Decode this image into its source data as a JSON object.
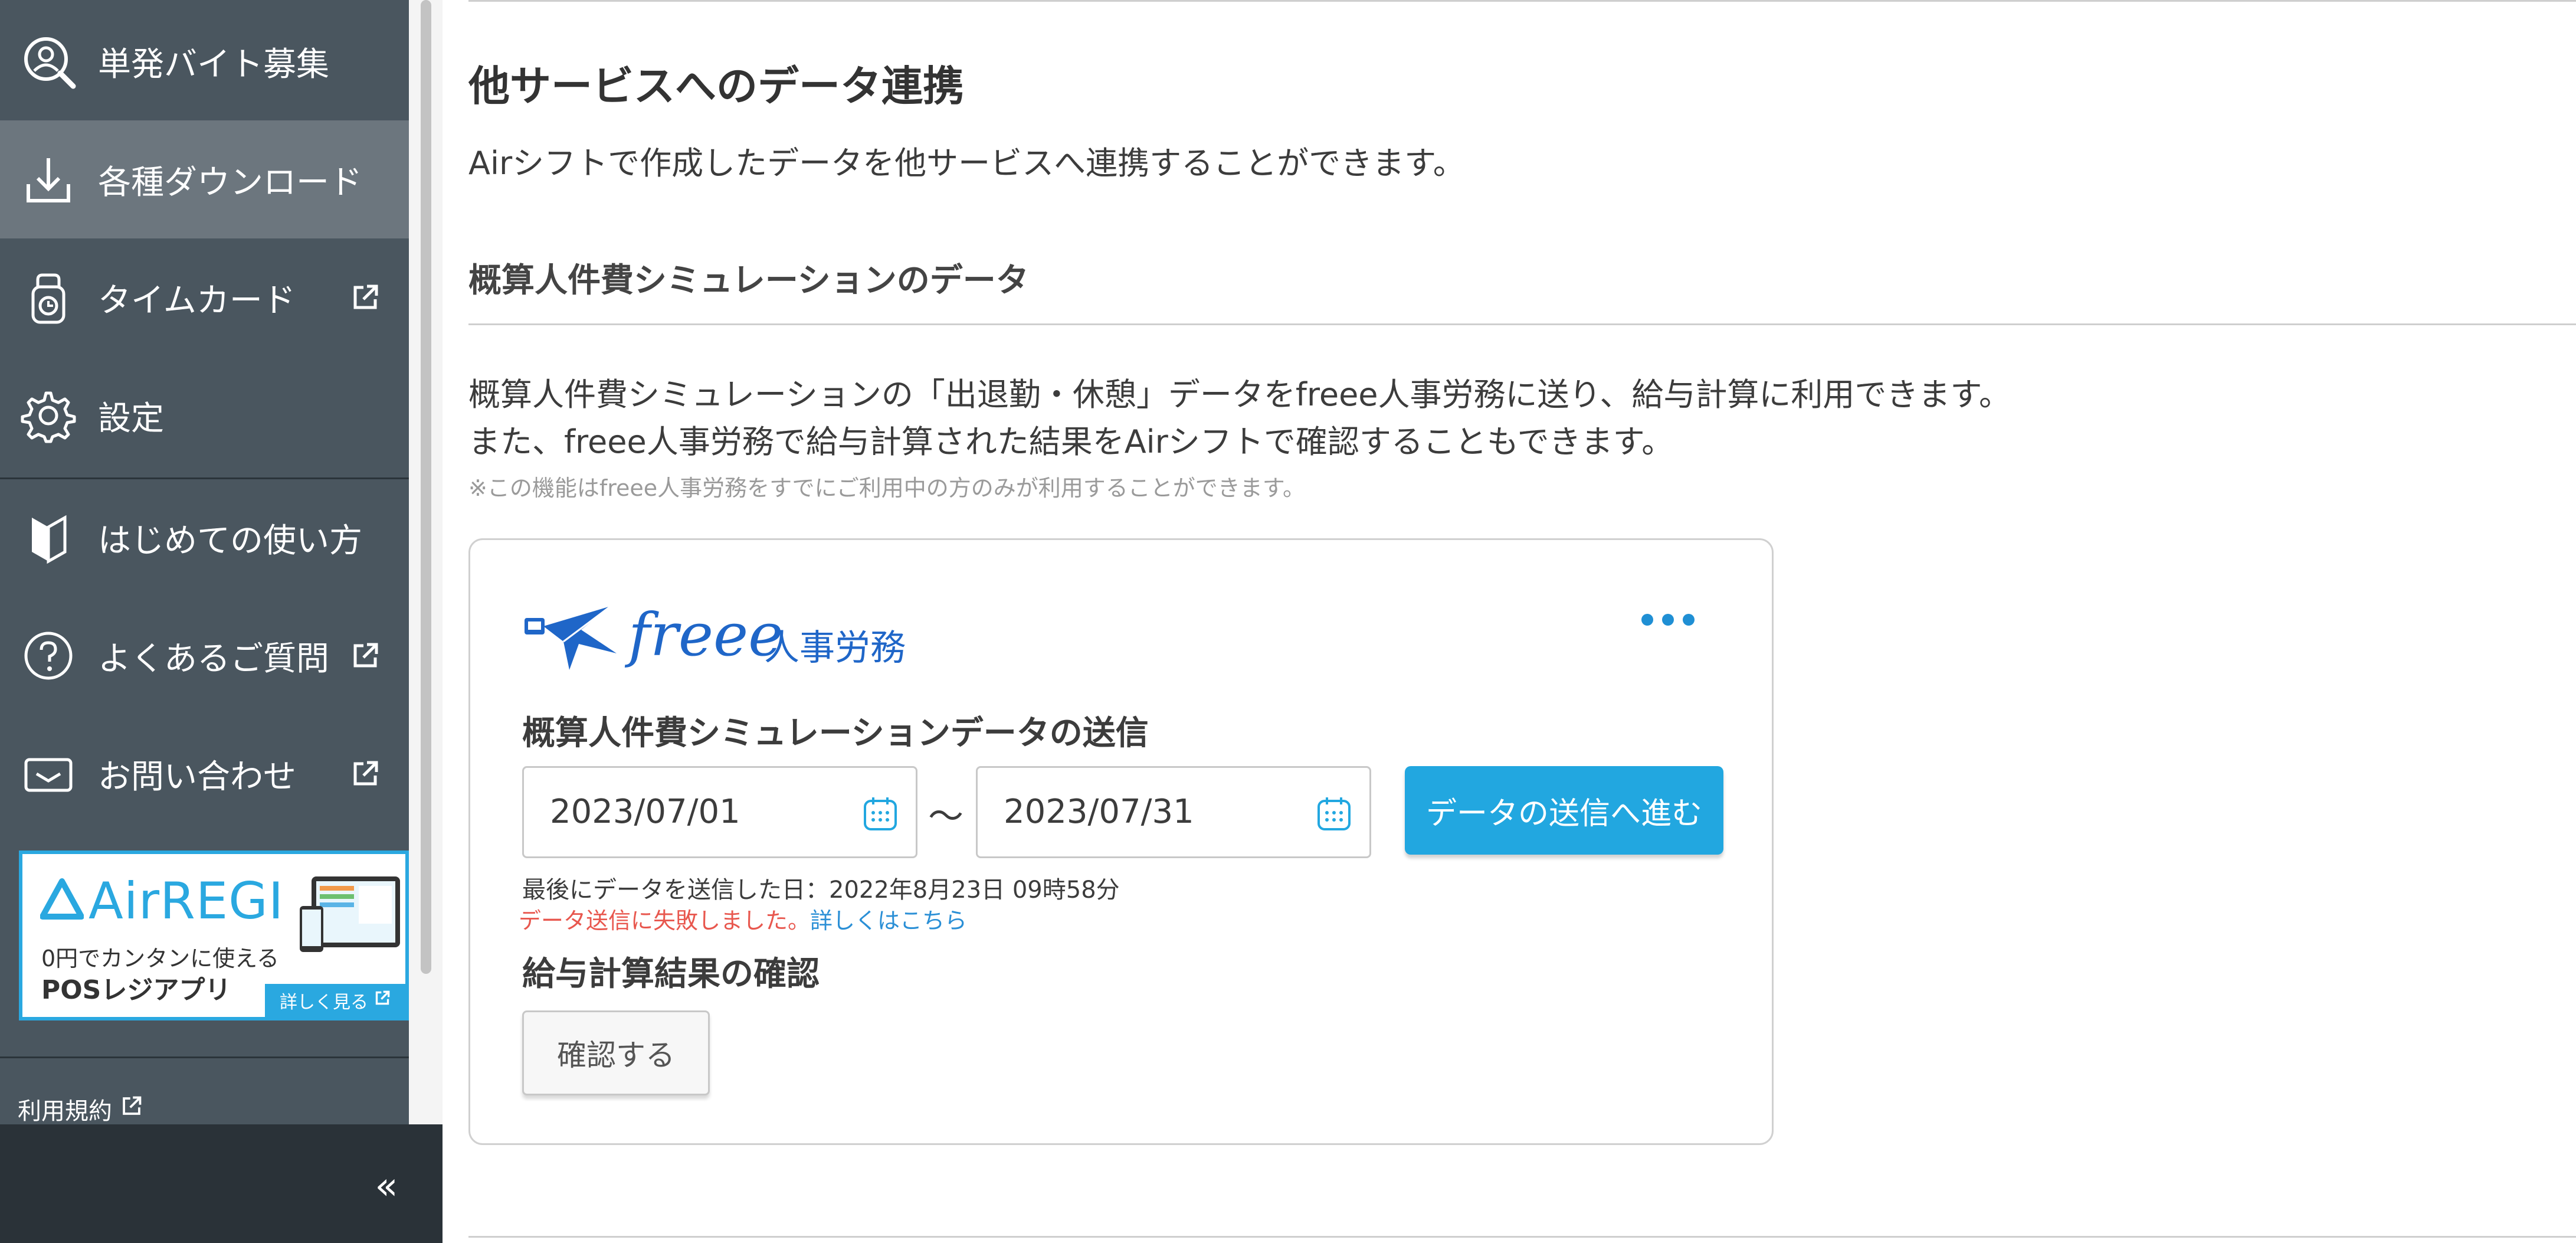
{
  "sidebar": {
    "items": [
      {
        "label": "単発バイト募集",
        "icon": "person-search-icon",
        "external": false,
        "active": false
      },
      {
        "label": "各種ダウンロード",
        "icon": "download-icon",
        "external": false,
        "active": true
      },
      {
        "label": "タイムカード",
        "icon": "timecard-icon",
        "external": true,
        "active": false
      },
      {
        "label": "設定",
        "icon": "gear-icon",
        "external": false,
        "active": false
      },
      {
        "label": "はじめての使い方",
        "icon": "beginner-mark-icon",
        "external": false,
        "active": false
      },
      {
        "label": "よくあるご質問",
        "icon": "help-circle-icon",
        "external": true,
        "active": false
      },
      {
        "label": "お問い合わせ",
        "icon": "mail-icon",
        "external": true,
        "active": false
      }
    ],
    "banner": {
      "brand": "AirREGI",
      "line1": "0円でカンタンに使える",
      "line2": "POSレジアプリ",
      "more": "詳しく見る"
    },
    "terms": "利用規約",
    "collapse": "«"
  },
  "main": {
    "title": "他サービスへのデータ連携",
    "description": "Airシフトで作成したデータを他サービスへ連携することができます。",
    "section": {
      "title": "概算人件費シミュレーションのデータ",
      "desc_line1": "概算人件費シミュレーションの「出退勤・休憩」データをfreee人事労務に送り、給与計算に利用できます。",
      "desc_line2": "また、freee人事労務で給与計算された結果をAirシフトで確認することもできます。",
      "note": "※この機能はfreee人事労務をすでにご利用中の方のみが利用することができます。"
    },
    "card": {
      "logo_text": "freee",
      "logo_sub": "人事労務",
      "send_title": "概算人件費シミュレーションデータの送信",
      "date_from": "2023/07/01",
      "date_to": "2023/07/31",
      "range_separator": "〜",
      "send_button": "データの送信へ進む",
      "last_sent": "最後にデータを送信した日：2022年8月23日 09時58分",
      "error_text": "データ送信に失敗しました。",
      "error_link": "詳しくはこちら",
      "result_title": "給与計算結果の確認",
      "confirm_button": "確認する"
    }
  },
  "colors": {
    "sidebar": "#4a565f",
    "sidebar_active": "#6c767e",
    "accent": "#22a7e0",
    "error": "#e8574e",
    "link": "#2a8fd6"
  }
}
